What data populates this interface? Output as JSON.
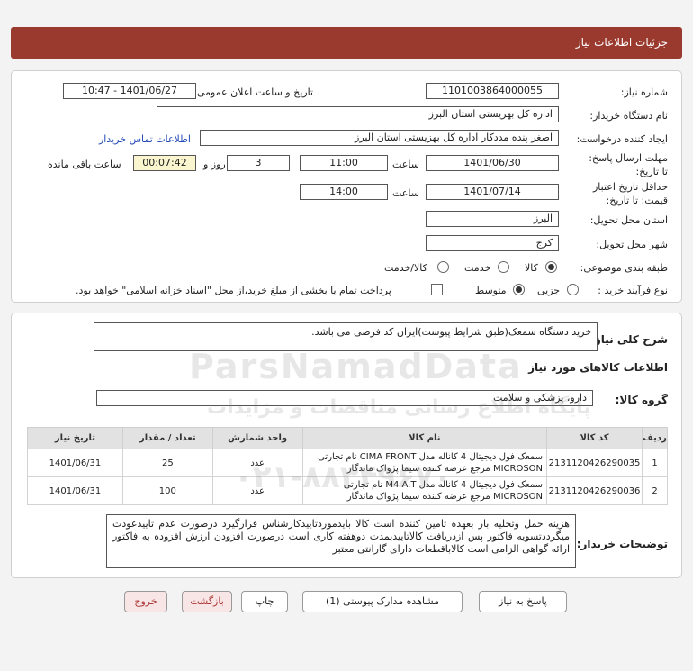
{
  "header": {
    "title": "جزئیات اطلاعات نیاز"
  },
  "form": {
    "need_number_label": "شماره نیاز:",
    "need_number": "1101003864000055",
    "announce_label": "تاریخ و ساعت اعلان عمومی:",
    "announce_value": "1401/06/27 - 10:47",
    "buyer_org_label": "نام دستگاه خریدار:",
    "buyer_org": "اداره کل بهزیستی استان البرز",
    "creator_label": "ایجاد کننده درخواست:",
    "creator": "اصغر پنده مددکار اداره کل بهزیستی استان البرز",
    "contact_link": "اطلاعات تماس خریدار",
    "send_deadline_label": "مهلت ارسال پاسخ: تا تاریخ:",
    "send_date": "1401/06/30",
    "time_label": "ساعت",
    "send_time": "11:00",
    "days_value": "3",
    "days_label": "روز و",
    "remaining_time": "00:07:42",
    "remaining_label": "ساعت باقی مانده",
    "validity_label": "حداقل تاریخ اعتبار قیمت: تا تاریخ:",
    "validity_date": "1401/07/14",
    "validity_time": "14:00",
    "province_label": "استان محل تحویل:",
    "province": "البرز",
    "city_label": "شهر محل تحویل:",
    "city": "کرج",
    "category_label": "طبقه بندی موضوعی:",
    "category_options": [
      "کالا",
      "خدمت",
      "کالا/خدمت"
    ],
    "category_selected": "کالا",
    "process_label": "نوع فرآیند خرید :",
    "process_options": [
      "جزیی",
      "متوسط"
    ],
    "process_selected": "متوسط",
    "payment_note": "پرداخت تمام یا بخشی از مبلغ خرید،از محل \"اسناد خزانه اسلامی\" خواهد بود."
  },
  "description": {
    "label": "شرح کلی نیاز:",
    "text": "خرید دستگاه سمعک(طبق شرایط پیوست)ایران کد فرضی می باشد."
  },
  "goods_info": {
    "title": "اطلاعات کالاهای مورد نیاز",
    "group_label": "گروه کالا:",
    "group_value": "دارو، پزشکی و سلامت",
    "columns": [
      "ردیف",
      "کد کالا",
      "نام کالا",
      "واحد شمارش",
      "تعداد / مقدار",
      "تاریخ نیاز"
    ],
    "rows": [
      {
        "row": "1",
        "code": "2131120426290035",
        "name": "سمعک فول دیجیتال 4 کاناله مدل CIMA FRONT نام تجارتی MICROSON مرجع عرضه کننده سیما پژواک ماندگار",
        "unit": "عدد",
        "qty": "25",
        "date": "1401/06/31"
      },
      {
        "row": "2",
        "code": "2131120426290036",
        "name": "سمعک فول دیجیتال 4 کاناله مدل M4 A.T نام تجارتی MICROSON مرجع عرضه کننده سیما پژواک ماندگار",
        "unit": "عدد",
        "qty": "100",
        "date": "1401/06/31"
      }
    ]
  },
  "buyer_notes": {
    "label": "توضیحات خریدار:",
    "text": "هزینه حمل وتخلیه بار بعهده تامین کننده است کالا بایدموردتاییدکارشناس قرارگیرد درصورت عدم تاییدعودت میگرددتسویه فاکتور پس ازدریافت کالاتاییدبمدت دوهفته کاری است درصورت افزودن ارزش افزوده به فاکتور ارائه گواهی الزامی است کالاباقطعات دارای گارانتی معتبر"
  },
  "buttons": {
    "reply": "پاسخ به نیاز",
    "attachments": "مشاهده مدارک پیوستی (1)",
    "print": "چاپ",
    "back": "بازگشت",
    "exit": "خروج"
  },
  "watermark": {
    "line1": "ParsNamadData",
    "line2": "پایگاه اطلاع رسانی مناقصات و مزایدات",
    "line3": "۰۲۱-۸۸۳۴۹۶۷۰"
  }
}
